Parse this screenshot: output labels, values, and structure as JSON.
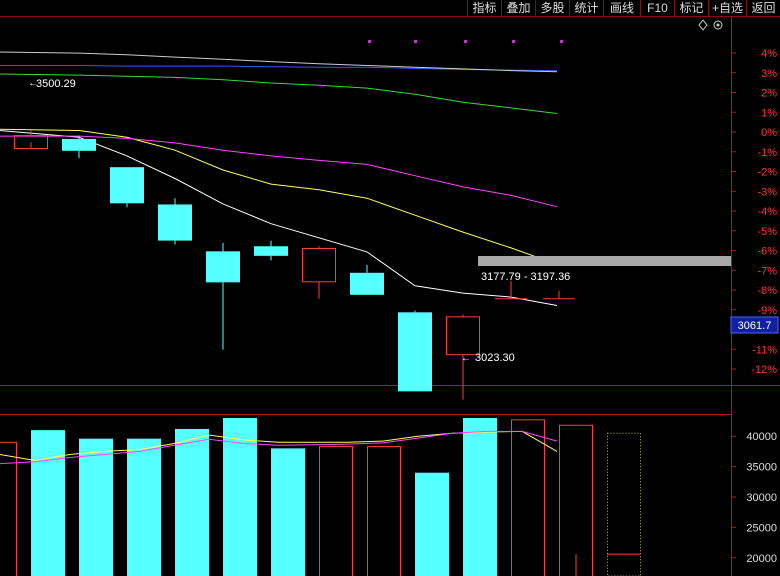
{
  "toolbar": {
    "buttons": [
      "指标",
      "叠加",
      "多股",
      "统计",
      "画线",
      "F10",
      "标记",
      "+自选",
      "返回"
    ],
    "icons": [
      "diamond-icon",
      "settings-icon"
    ]
  },
  "colors": {
    "up": "#ff3c3c",
    "down": "#54ffff",
    "axis": "#b01818",
    "ma5": "#ffffff",
    "ma10": "#ffff55",
    "ma20": "#ff44ff",
    "ma60": "#33dd33",
    "ma120": "#3355ff",
    "ma250": "#cccccc",
    "pct_label": "#ff3333",
    "vol_label": "#dddddd",
    "annotation": "#ffffff"
  },
  "price_axis": {
    "labels": [
      "4%",
      "3%",
      "2%",
      "1%",
      "0%",
      "-1%",
      "-2%",
      "-3%",
      "-4%",
      "-5%",
      "-6%",
      "-7%",
      "-8%",
      "-9%",
      "-10%",
      "-11%",
      "-12%"
    ],
    "current_price": "3061.7"
  },
  "volume_axis": {
    "labels": [
      "40000",
      "35000",
      "30000",
      "25000",
      "20000"
    ]
  },
  "annotations": {
    "high": "3500.29",
    "range": "3177.79 - 3197.36",
    "low": "3023.30"
  },
  "chart_data": {
    "type": "candlestick",
    "base_close": 3497.3,
    "y_percent_range": [
      -12.5,
      4.5
    ],
    "candles": [
      {
        "open": 3468.0,
        "close": 3491.0,
        "high": 3500.29,
        "low": 3479.0
      },
      {
        "open": 3485.0,
        "close": 3464.0,
        "high": 3491.0,
        "low": 3451.0
      },
      {
        "open": 3435.0,
        "close": 3371.0,
        "high": 3435.0,
        "low": 3364.0
      },
      {
        "open": 3369.0,
        "close": 3305.0,
        "high": 3380.0,
        "low": 3298.0
      },
      {
        "open": 3286.0,
        "close": 3231.0,
        "high": 3301.0,
        "low": 3112.0
      },
      {
        "open": 3295.0,
        "close": 3278.0,
        "high": 3305.0,
        "low": 3270.0
      },
      {
        "open": 3232.0,
        "close": 3291.0,
        "high": 3295.0,
        "low": 3202.0
      },
      {
        "open": 3248.0,
        "close": 3209.0,
        "high": 3262.0,
        "low": 3209.0
      },
      {
        "open": 3178.0,
        "close": 3038.0,
        "high": 3181.0,
        "low": 3038.0
      },
      {
        "open": 3103.0,
        "close": 3170.0,
        "high": 3174.0,
        "low": 3023.3
      }
    ],
    "projection_markers": [
      {
        "price": 3202.0,
        "high": 3233.0
      },
      {
        "price": 3202.0,
        "high": 3216.0
      }
    ],
    "ma_lines": [
      {
        "key": "ma5",
        "values": [
          3500,
          3488,
          3455,
          3415,
          3370,
          3335,
          3310,
          3285,
          3225,
          3212,
          3205,
          3190
        ]
      },
      {
        "key": "ma10",
        "values": [
          3502,
          3500,
          3488,
          3465,
          3430,
          3405,
          3395,
          3380,
          3350,
          3320,
          3292,
          3263
        ]
      },
      {
        "key": "ma20",
        "values": [
          3490,
          3490,
          3486,
          3478,
          3465,
          3455,
          3447,
          3440,
          3420,
          3400,
          3385,
          3365
        ]
      },
      {
        "key": "ma60",
        "values": [
          3600,
          3598,
          3596,
          3594,
          3590,
          3584,
          3580,
          3575,
          3564,
          3550,
          3540,
          3530
        ]
      },
      {
        "key": "ma120",
        "values": [
          3615,
          3615,
          3614,
          3614,
          3614,
          3613,
          3612,
          3612,
          3610,
          3608,
          3607,
          3606
        ]
      },
      {
        "key": "ma250",
        "values": [
          3639,
          3637,
          3634,
          3630,
          3626,
          3622,
          3618,
          3615,
          3612,
          3609,
          3606,
          3604
        ]
      }
    ],
    "volume": {
      "ylim": [
        17000,
        43000
      ],
      "bars": [
        {
          "value": 39000,
          "up": true
        },
        {
          "value": 41000,
          "up": false
        },
        {
          "value": 39600,
          "up": false
        },
        {
          "value": 39600,
          "up": false
        },
        {
          "value": 41200,
          "up": false
        },
        {
          "value": 43000,
          "up": false
        },
        {
          "value": 38000,
          "up": false
        },
        {
          "value": 38300,
          "up": true
        },
        {
          "value": 38300,
          "up": true
        },
        {
          "value": 34000,
          "up": false
        },
        {
          "value": 43000,
          "up": false
        },
        {
          "value": 42700,
          "up": true
        },
        {
          "value": 41800,
          "up": true
        },
        {
          "value": 40500,
          "up": false,
          "projection": true
        }
      ],
      "ma_lines": [
        {
          "key": "ma10",
          "values": [
            37000,
            36000,
            37000,
            37500,
            37800,
            38800,
            40200,
            39400,
            39000,
            39000,
            39000,
            39200,
            40000,
            40500,
            40700,
            40800,
            37500
          ]
        },
        {
          "key": "ma20",
          "values": [
            35500,
            35800,
            36500,
            37000,
            37500,
            38500,
            39500,
            38800,
            38500,
            38600,
            38700,
            38900,
            39700,
            40500,
            40800,
            40800,
            39200
          ]
        }
      ]
    }
  }
}
